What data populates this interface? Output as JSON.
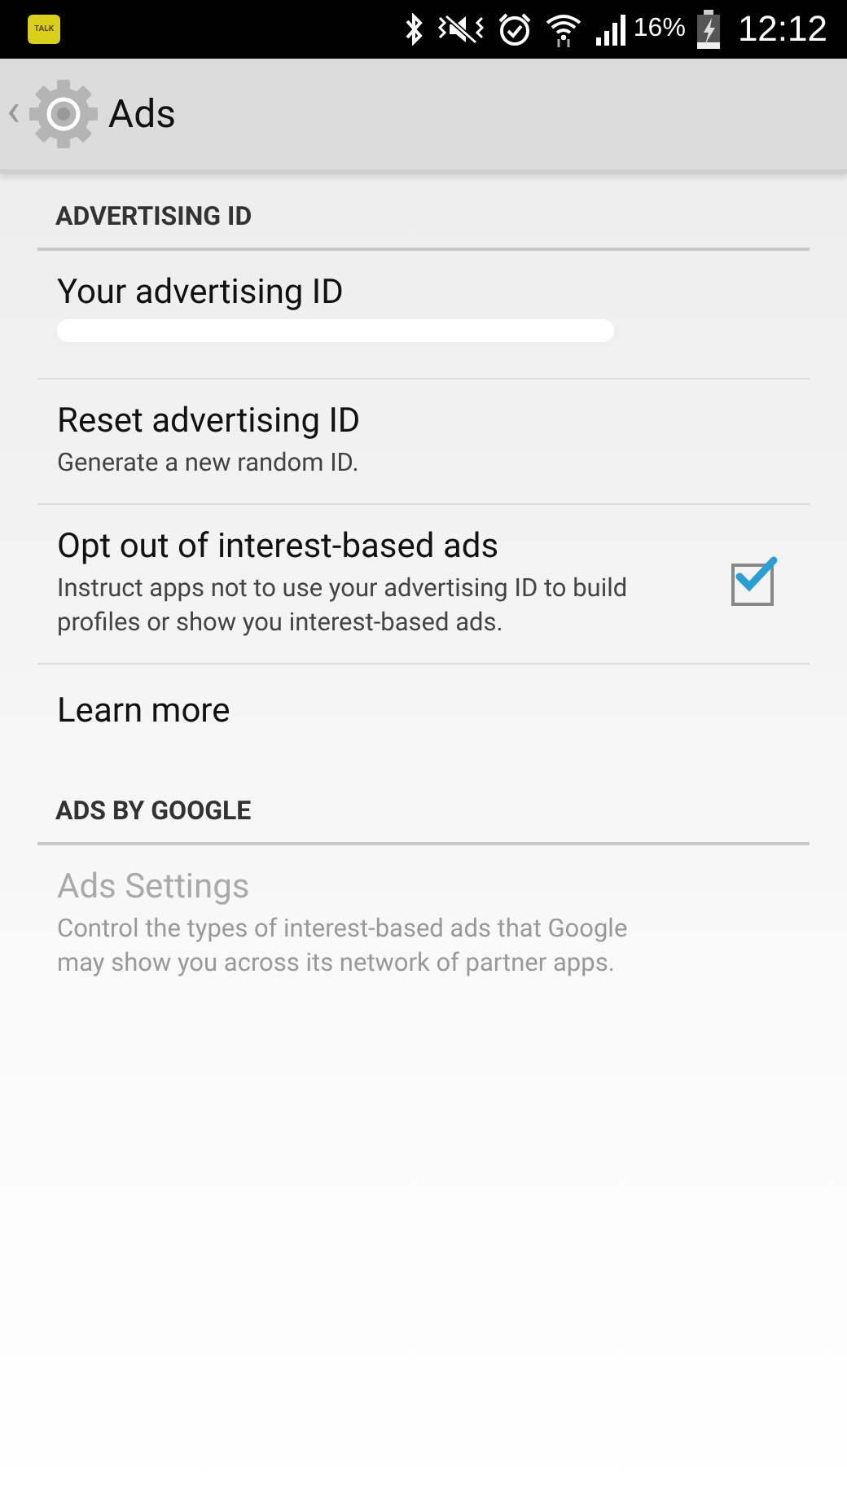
{
  "status_bar": {
    "notification_icon_label": "TALK",
    "signal_strength_label": "16%",
    "time": "12:12"
  },
  "action_bar": {
    "back": "‹",
    "title": "Ads"
  },
  "sections": [
    {
      "header": "ADVERTISING ID",
      "items": [
        {
          "kind": "redacted",
          "title": "Your advertising ID",
          "disabled": false
        },
        {
          "kind": "plain",
          "title": "Reset advertising ID",
          "summary": "Generate a new random ID.",
          "disabled": false
        },
        {
          "kind": "checkbox",
          "title": "Opt out of interest-based ads",
          "summary": "Instruct apps not to use your advertising ID to build profiles or show you interest-based ads.",
          "checked": true,
          "disabled": false
        },
        {
          "kind": "plain",
          "title": "Learn more",
          "disabled": false
        }
      ]
    },
    {
      "header": "ADS BY GOOGLE",
      "items": [
        {
          "kind": "plain",
          "title": "Ads Settings",
          "summary": "Control the types of interest-based ads that Google may show you across its network of partner apps.",
          "disabled": true
        }
      ]
    }
  ]
}
